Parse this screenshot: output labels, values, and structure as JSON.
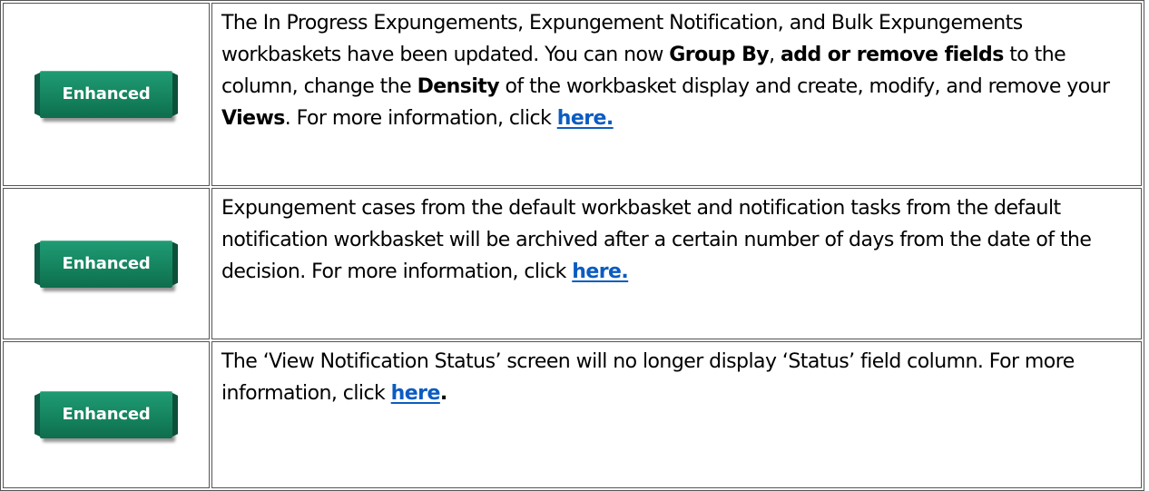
{
  "rows": [
    {
      "badge": "Enhanced",
      "segments": [
        "The In Progress Expungements, Expungement Notification, and Bulk Expungements workbaskets have been updated. You can now ",
        "Group By",
        ", ",
        "add or remove fields",
        " to the column, change the ",
        "Density",
        " of the workbasket display and create, modify, and remove your ",
        "Views",
        ". For more information, click "
      ],
      "link": "here."
    },
    {
      "badge": "Enhanced",
      "segments": [
        "Expungement cases from the default workbasket and notification tasks from the default notification workbasket will be archived after a certain number of days from the date of the decision. For more information, click "
      ],
      "link": "here."
    },
    {
      "badge": "Enhanced",
      "segments": [
        "The ‘View Notification Status’ screen will no longer display ‘Status’ field column. For more information, click "
      ],
      "link": "here",
      "trailing": "."
    }
  ],
  "colors": {
    "badge_green": "#15845f",
    "link_blue": "#0b5cc1",
    "border": "#555555"
  }
}
